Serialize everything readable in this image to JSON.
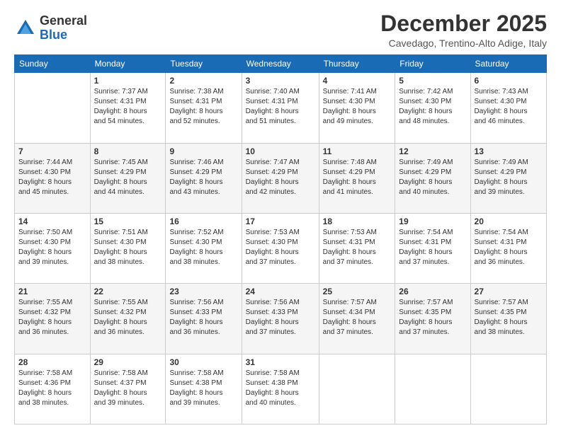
{
  "logo": {
    "general": "General",
    "blue": "Blue"
  },
  "title": "December 2025",
  "location": "Cavedago, Trentino-Alto Adige, Italy",
  "days_of_week": [
    "Sunday",
    "Monday",
    "Tuesday",
    "Wednesday",
    "Thursday",
    "Friday",
    "Saturday"
  ],
  "weeks": [
    [
      {
        "day": "",
        "info": ""
      },
      {
        "day": "1",
        "info": "Sunrise: 7:37 AM\nSunset: 4:31 PM\nDaylight: 8 hours\nand 54 minutes."
      },
      {
        "day": "2",
        "info": "Sunrise: 7:38 AM\nSunset: 4:31 PM\nDaylight: 8 hours\nand 52 minutes."
      },
      {
        "day": "3",
        "info": "Sunrise: 7:40 AM\nSunset: 4:31 PM\nDaylight: 8 hours\nand 51 minutes."
      },
      {
        "day": "4",
        "info": "Sunrise: 7:41 AM\nSunset: 4:30 PM\nDaylight: 8 hours\nand 49 minutes."
      },
      {
        "day": "5",
        "info": "Sunrise: 7:42 AM\nSunset: 4:30 PM\nDaylight: 8 hours\nand 48 minutes."
      },
      {
        "day": "6",
        "info": "Sunrise: 7:43 AM\nSunset: 4:30 PM\nDaylight: 8 hours\nand 46 minutes."
      }
    ],
    [
      {
        "day": "7",
        "info": "Sunrise: 7:44 AM\nSunset: 4:30 PM\nDaylight: 8 hours\nand 45 minutes."
      },
      {
        "day": "8",
        "info": "Sunrise: 7:45 AM\nSunset: 4:29 PM\nDaylight: 8 hours\nand 44 minutes."
      },
      {
        "day": "9",
        "info": "Sunrise: 7:46 AM\nSunset: 4:29 PM\nDaylight: 8 hours\nand 43 minutes."
      },
      {
        "day": "10",
        "info": "Sunrise: 7:47 AM\nSunset: 4:29 PM\nDaylight: 8 hours\nand 42 minutes."
      },
      {
        "day": "11",
        "info": "Sunrise: 7:48 AM\nSunset: 4:29 PM\nDaylight: 8 hours\nand 41 minutes."
      },
      {
        "day": "12",
        "info": "Sunrise: 7:49 AM\nSunset: 4:29 PM\nDaylight: 8 hours\nand 40 minutes."
      },
      {
        "day": "13",
        "info": "Sunrise: 7:49 AM\nSunset: 4:29 PM\nDaylight: 8 hours\nand 39 minutes."
      }
    ],
    [
      {
        "day": "14",
        "info": "Sunrise: 7:50 AM\nSunset: 4:30 PM\nDaylight: 8 hours\nand 39 minutes."
      },
      {
        "day": "15",
        "info": "Sunrise: 7:51 AM\nSunset: 4:30 PM\nDaylight: 8 hours\nand 38 minutes."
      },
      {
        "day": "16",
        "info": "Sunrise: 7:52 AM\nSunset: 4:30 PM\nDaylight: 8 hours\nand 38 minutes."
      },
      {
        "day": "17",
        "info": "Sunrise: 7:53 AM\nSunset: 4:30 PM\nDaylight: 8 hours\nand 37 minutes."
      },
      {
        "day": "18",
        "info": "Sunrise: 7:53 AM\nSunset: 4:31 PM\nDaylight: 8 hours\nand 37 minutes."
      },
      {
        "day": "19",
        "info": "Sunrise: 7:54 AM\nSunset: 4:31 PM\nDaylight: 8 hours\nand 37 minutes."
      },
      {
        "day": "20",
        "info": "Sunrise: 7:54 AM\nSunset: 4:31 PM\nDaylight: 8 hours\nand 36 minutes."
      }
    ],
    [
      {
        "day": "21",
        "info": "Sunrise: 7:55 AM\nSunset: 4:32 PM\nDaylight: 8 hours\nand 36 minutes."
      },
      {
        "day": "22",
        "info": "Sunrise: 7:55 AM\nSunset: 4:32 PM\nDaylight: 8 hours\nand 36 minutes."
      },
      {
        "day": "23",
        "info": "Sunrise: 7:56 AM\nSunset: 4:33 PM\nDaylight: 8 hours\nand 36 minutes."
      },
      {
        "day": "24",
        "info": "Sunrise: 7:56 AM\nSunset: 4:33 PM\nDaylight: 8 hours\nand 37 minutes."
      },
      {
        "day": "25",
        "info": "Sunrise: 7:57 AM\nSunset: 4:34 PM\nDaylight: 8 hours\nand 37 minutes."
      },
      {
        "day": "26",
        "info": "Sunrise: 7:57 AM\nSunset: 4:35 PM\nDaylight: 8 hours\nand 37 minutes."
      },
      {
        "day": "27",
        "info": "Sunrise: 7:57 AM\nSunset: 4:35 PM\nDaylight: 8 hours\nand 38 minutes."
      }
    ],
    [
      {
        "day": "28",
        "info": "Sunrise: 7:58 AM\nSunset: 4:36 PM\nDaylight: 8 hours\nand 38 minutes."
      },
      {
        "day": "29",
        "info": "Sunrise: 7:58 AM\nSunset: 4:37 PM\nDaylight: 8 hours\nand 39 minutes."
      },
      {
        "day": "30",
        "info": "Sunrise: 7:58 AM\nSunset: 4:38 PM\nDaylight: 8 hours\nand 39 minutes."
      },
      {
        "day": "31",
        "info": "Sunrise: 7:58 AM\nSunset: 4:38 PM\nDaylight: 8 hours\nand 40 minutes."
      },
      {
        "day": "",
        "info": ""
      },
      {
        "day": "",
        "info": ""
      },
      {
        "day": "",
        "info": ""
      }
    ]
  ]
}
